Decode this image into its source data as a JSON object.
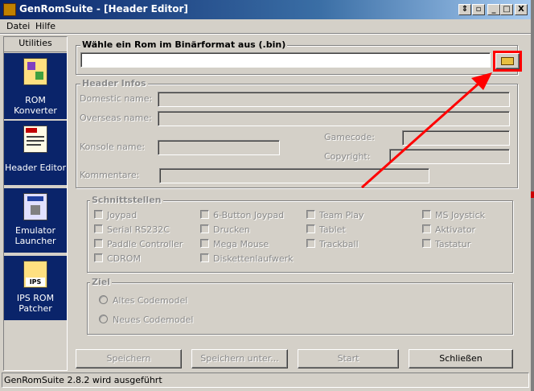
{
  "window": {
    "title": "GenRomSuite - [Header Editor]",
    "title_color": "#0a246a",
    "controls": {
      "restore_mdi": "⇕",
      "restore": "▫",
      "minimize": "_",
      "maximize": "□",
      "close": "X"
    }
  },
  "menu": {
    "items": [
      "Datei",
      "Hilfe"
    ]
  },
  "sidebar": {
    "header": "Utilities",
    "items": [
      {
        "label_lines": [
          "ROM Konverter"
        ],
        "icon": "rom-converter-icon"
      },
      {
        "label_lines": [
          "Header Editor"
        ],
        "icon": "header-editor-icon"
      },
      {
        "label_lines": [
          "Emulator",
          "Launcher"
        ],
        "icon": "emulator-launcher-icon"
      },
      {
        "label_lines": [
          "IPS ROM",
          "Patcher"
        ],
        "icon": "ips-patcher-icon",
        "icon_text": "IPS"
      }
    ]
  },
  "rom_select": {
    "title": "Wähle ein Rom im Binärformat aus (.bin)",
    "path_value": "",
    "browse_icon": "folder-open-icon",
    "highlight_color": "#ff0000"
  },
  "header_infos": {
    "title": "Header Infos",
    "domestic_name_label": "Domestic name:",
    "overseas_name_label": "Overseas name:",
    "gamecode_label": "Gamecode:",
    "konsole_name_label": "Konsole name:",
    "copyright_label": "Copyright:",
    "kommentare_label": "Kommentare:"
  },
  "schnittstellen": {
    "title": "Schnittstellen",
    "col1": [
      "Joypad",
      "Serial RS232C",
      "Paddle Controller",
      "CDROM"
    ],
    "col2": [
      "6-Button Joypad",
      "Drucken",
      "Mega Mouse",
      "Diskettenlaufwerk"
    ],
    "col3": [
      "Team Play",
      "Tablet",
      "Trackball"
    ],
    "col4": [
      "MS Joystick",
      "Aktivator",
      "Tastatur"
    ]
  },
  "ziel": {
    "title": "Ziel",
    "options": [
      "Altes Codemodel",
      "Neues Codemodel"
    ]
  },
  "buttons": {
    "save": "Speichern",
    "save_as": "Speichern unter...",
    "start": "Start",
    "close": "Schließen"
  },
  "status": {
    "text": "GenRomSuite 2.8.2 wird ausgeführt"
  },
  "annotation": {
    "arrow_color": "#ff0000"
  }
}
